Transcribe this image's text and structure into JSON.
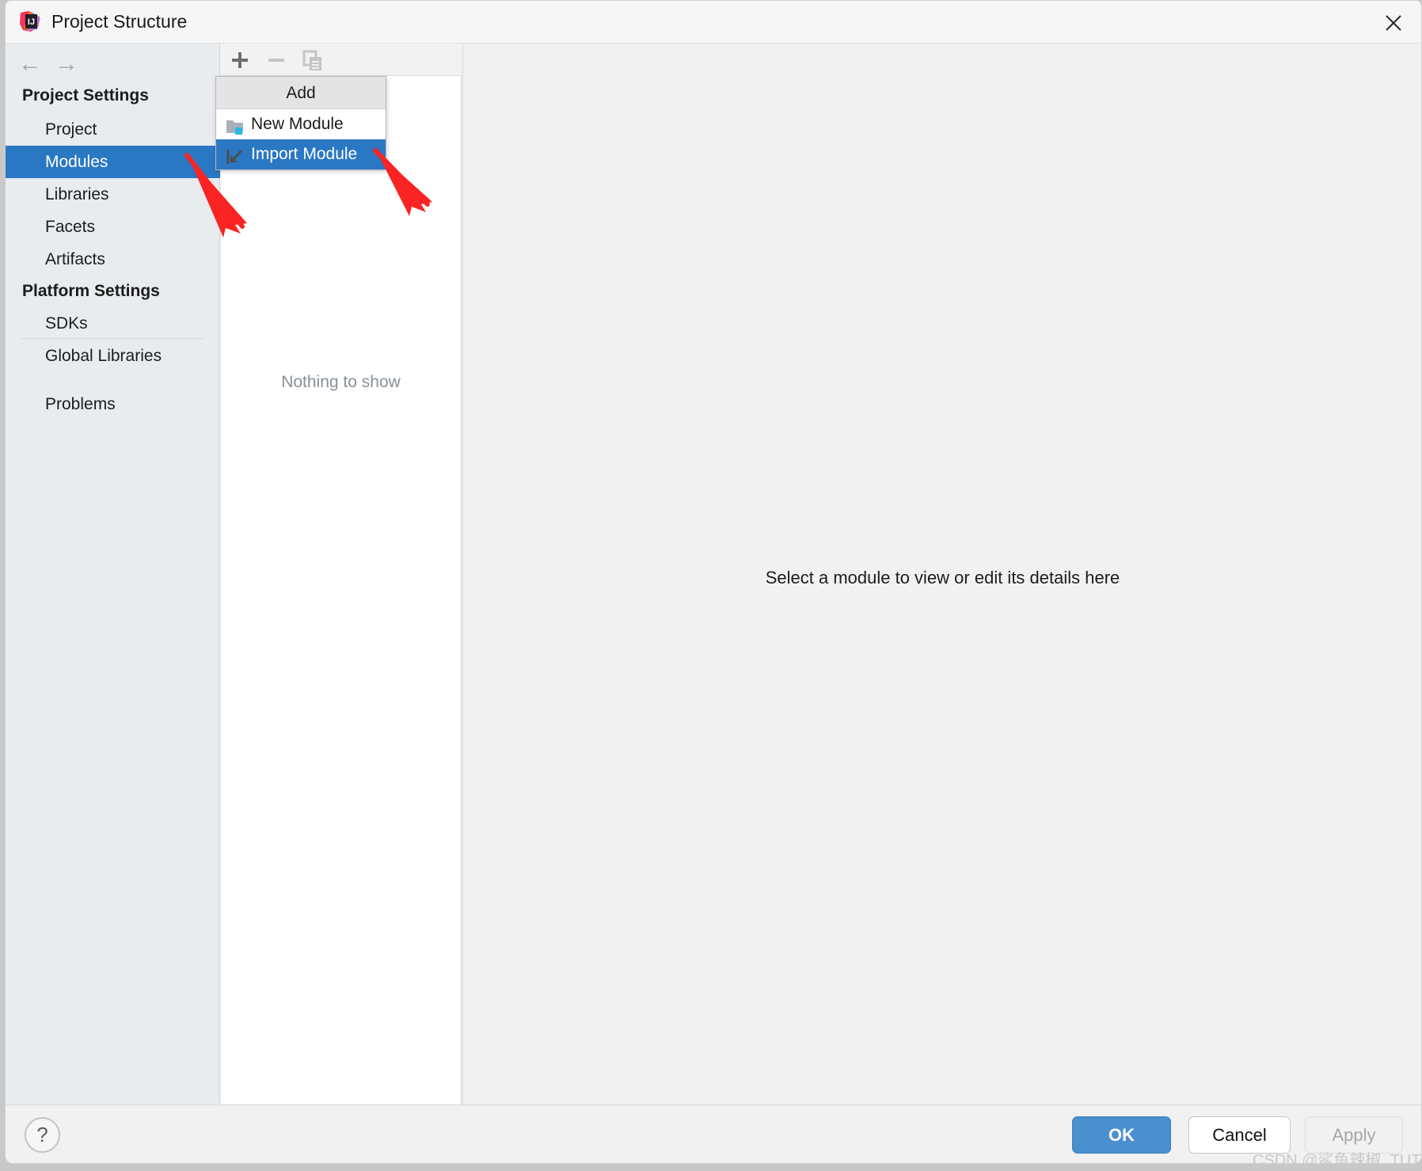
{
  "window": {
    "title": "Project Structure",
    "app_icon": "intellij-idea-icon",
    "close_label": "×"
  },
  "sidebar": {
    "nav": {
      "back": "←",
      "forward": "→"
    },
    "groups": [
      {
        "label": "Project Settings",
        "items": [
          {
            "label": "Project",
            "selected": false
          },
          {
            "label": "Modules",
            "selected": true
          },
          {
            "label": "Libraries",
            "selected": false
          },
          {
            "label": "Facets",
            "selected": false
          },
          {
            "label": "Artifacts",
            "selected": false
          }
        ]
      },
      {
        "label": "Platform Settings",
        "items": [
          {
            "label": "SDKs",
            "selected": false
          },
          {
            "label": "Global Libraries",
            "selected": false
          }
        ]
      }
    ],
    "extra": [
      {
        "label": "Problems",
        "selected": false
      }
    ]
  },
  "middle_panel": {
    "toolbar": [
      {
        "name": "add-button",
        "glyph": "+"
      },
      {
        "name": "remove-button",
        "glyph": "−"
      },
      {
        "name": "copy-button",
        "glyph": "copy"
      }
    ],
    "empty_text": "Nothing to show"
  },
  "popup_menu": {
    "header": "Add",
    "items": [
      {
        "label": "New Module",
        "icon": "new-module-folder-icon",
        "highlighted": false
      },
      {
        "label": "Import Module",
        "icon": "import-module-arrow-icon",
        "highlighted": true
      }
    ]
  },
  "right_panel": {
    "hint": "Select a module to view or edit its details here"
  },
  "footer": {
    "help": "?",
    "ok": "OK",
    "cancel": "Cancel",
    "apply": "Apply"
  },
  "watermark": "CSDN @鲨鱼辣椒_TUT",
  "colors": {
    "accent_blue": "#2a78c4",
    "ok_button_blue": "#4a8fce",
    "sidebar_bg": "#e8ecef",
    "dialog_bg": "#f2f2f2",
    "annotation_red": "#fa2424"
  }
}
